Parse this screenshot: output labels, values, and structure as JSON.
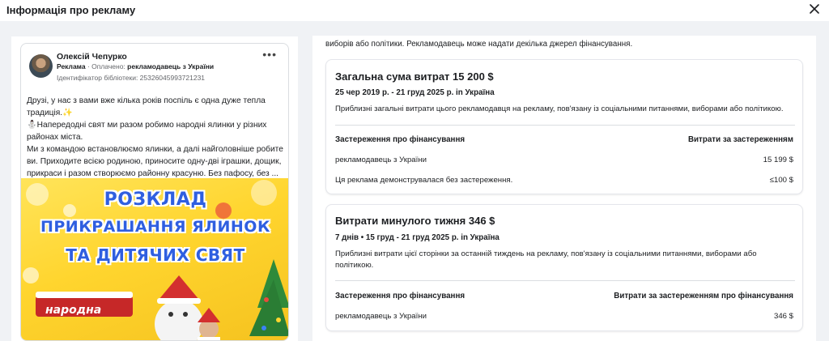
{
  "dialog": {
    "title": "Інформація про рекламу"
  },
  "post": {
    "author": "Олексій Чепурко",
    "meta_label": "Реклама",
    "meta_paid_prefix": "· Оплачено: ",
    "meta_payer": "рекламодавець з України",
    "library_id": "Ідентифікатор бібліотеки: 25326045993721231",
    "text_lines": [
      "Друзі, у нас з вами вже кілька років поспіль є одна дуже тепла традиція.✨",
      "⛄Напередодні свят ми разом робимо народні ялинки у різних районах міста.",
      "Ми з командою встановлюємо ялинки, а далі найголовніше робите ви. Приходите всією родиною, приносите одну-дві іграшки, дощик, прикраси і разом створюємо районну красуню. Без пафосу, без ..."
    ],
    "image": {
      "line1": "РОЗКЛАД",
      "line2": "ПРИКРАШАННЯ ЯЛИНОК",
      "line3": "ТА ДИТЯЧИХ СВЯТ",
      "sign": "народна"
    }
  },
  "intro_text": "виборів або політики. Рекламодавець може надати декілька джерел фінансування.",
  "total": {
    "heading": "Загальна сума витрат 15 200 $",
    "dates": "25 чер 2019 р. - 21 груд 2025 р. in Україна",
    "description": "Приблизні загальні витрати цього рекламодавця на рекламу, пов'язану із соціальними питаннями, виборами або політикою.",
    "col_left": "Застереження про фінансування",
    "col_right": "Витрати за застереженням",
    "rows": [
      {
        "label": "рекламодавець з України",
        "value": "15 199 $"
      },
      {
        "label": "Ця реклама демонструвалася без застереження.",
        "value": "≤100 $"
      }
    ]
  },
  "week": {
    "heading": "Витрати минулого тижня 346 $",
    "dates": "7 днів • 15 груд - 21 груд 2025 р. in Україна",
    "description": "Приблизні витрати цієї сторінки за останній тиждень на рекламу, пов'язану із соціальними питаннями, виборами або політикою.",
    "col_left": "Застереження про фінансування",
    "col_right": "Витрати за застереженням про фінансування",
    "rows": [
      {
        "label": "рекламодавець з України",
        "value": "346 $"
      }
    ]
  }
}
